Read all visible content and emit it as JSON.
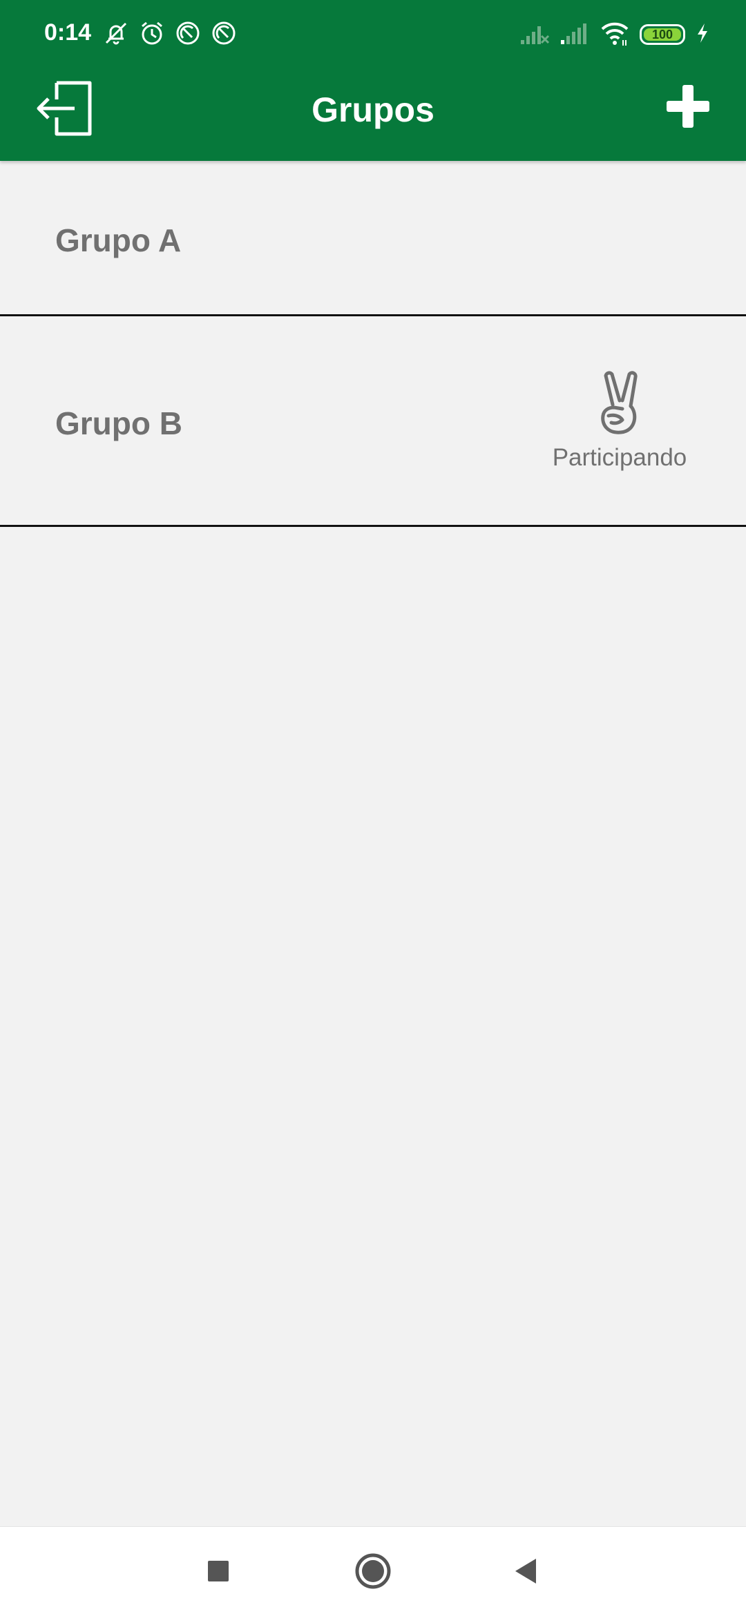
{
  "status_bar": {
    "time": "0:14",
    "left_icons": [
      "muted-bell-icon",
      "alarm-icon",
      "sync-icon",
      "sync-icon"
    ],
    "right_icons": [
      "signal-no-service-icon",
      "signal-icon",
      "wifi-icon"
    ],
    "battery_level": "100",
    "battery_color": "#8bd43a"
  },
  "header": {
    "title": "Grupos",
    "left_icon": "logout-icon",
    "right_icon": "plus-icon",
    "background_color": "#06793b"
  },
  "groups": [
    {
      "name": "Grupo A",
      "participating": false
    },
    {
      "name": "Grupo B",
      "participating": true,
      "status_icon": "victory-hand-icon",
      "status_label": "Participando"
    }
  ],
  "nav_bar": {
    "buttons": [
      "recents-button",
      "home-button",
      "back-button"
    ]
  }
}
